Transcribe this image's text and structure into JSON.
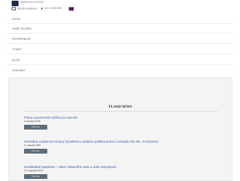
{
  "header": {
    "tagline": "Sledujte nás na LinkedIn",
    "email": "office@consulting.sk",
    "phone": "+421 2 5263 3849",
    "language_flag": "uk-flag-icon"
  },
  "nav": {
    "items": [
      "ÚVOD",
      "NAŠE SLUŽBY",
      "REFERENCIE",
      "O NÁS",
      "BLOG",
      "KONTAKT"
    ]
  },
  "flash": {
    "title": "FLASH NEWS",
    "items": [
      {
        "title": "Práva a povinnosti rodičov po rozvode",
        "date": "6. februára 2025",
        "button": "Čítať viac"
      },
      {
        "title": "Absolútna neplatnosť zmluvy (k jednému osobitne publikovanému rozsudku NS SR - R 51/2024)",
        "date": "21. januára 2025",
        "button": "Čítať viac"
      },
      {
        "title": "Neodkladné opatrenia – nález Ústavného súdu a naše zamyslenie",
        "date": "21. novembra 2024",
        "button": "Čítať viac"
      }
    ]
  },
  "colors": {
    "link": "#2a55a4",
    "button_bg": "#5d6d78",
    "panel_bg": "#f4f4f4",
    "logo": "#1b2b4a"
  }
}
